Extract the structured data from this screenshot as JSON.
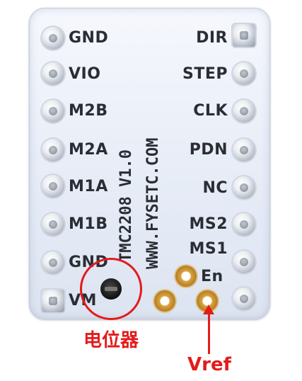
{
  "pins_left": [
    "GND",
    "VIO",
    "M2B",
    "M2A",
    "M1A",
    "M1B",
    "GND",
    "VM"
  ],
  "pins_right": [
    "DIR",
    "STEP",
    "CLK",
    "PDN",
    "NC",
    "MS2",
    "MS1"
  ],
  "board_text": {
    "model": "TMC2208 V1.0",
    "url": "WWW.FYSETC.COM"
  },
  "pad_labels": {
    "en": "En"
  },
  "annotations": {
    "potentiometer": "电位器",
    "vref": "Vref"
  },
  "colors": {
    "annotation": "#e31b1b",
    "board": "#e9eef8",
    "label": "#2a2d33"
  }
}
